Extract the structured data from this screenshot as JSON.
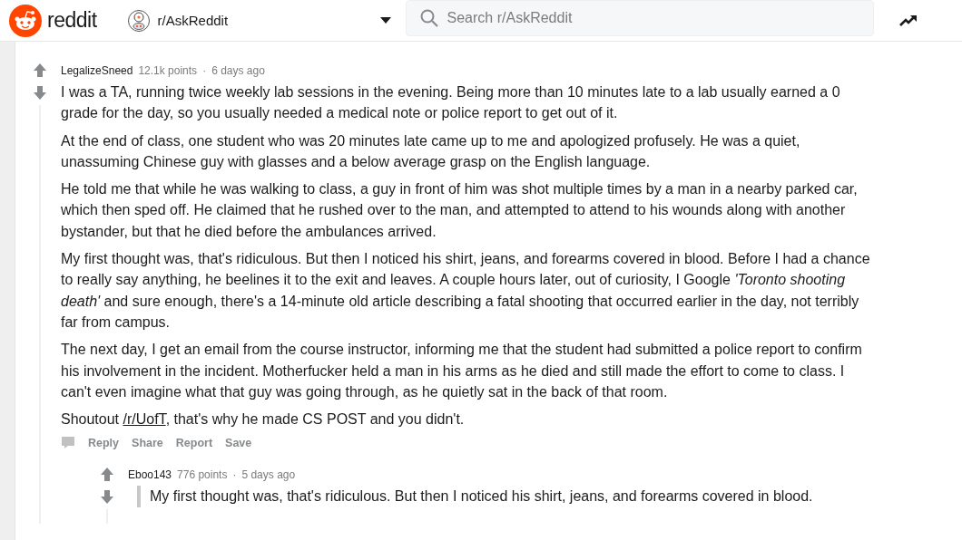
{
  "header": {
    "logo_text": "reddit",
    "subreddit": "r/AskReddit",
    "search": {
      "placeholder": "Search r/AskReddit"
    }
  },
  "comments": [
    {
      "author": "LegalizeSneed",
      "points": "12.1k points",
      "separator": "·",
      "time": "6 days ago",
      "paragraphs": [
        {
          "kind": "text",
          "parts": [
            {
              "kind": "text",
              "text": "I was a TA, running twice weekly lab sessions in the evening. Being more than 10 minutes late to a lab usually earned a 0 grade for the day, so you usually needed a medical note or police report to get out of it."
            }
          ]
        },
        {
          "kind": "text",
          "parts": [
            {
              "kind": "text",
              "text": "At the end of class, one student who was 20 minutes late came up to me and apologized profusely. He was a quiet, unassuming Chinese guy with glasses and a below average grasp on the English language."
            }
          ]
        },
        {
          "kind": "text",
          "parts": [
            {
              "kind": "text",
              "text": "He told me that while he was walking to class, a guy in front of him was shot multiple times by a man in a nearby parked car, which then sped off. He claimed that he rushed over to the man, and attempted to attend to his wounds along with another bystander, but that he died before the ambulances arrived."
            }
          ]
        },
        {
          "kind": "text",
          "parts": [
            {
              "kind": "text",
              "text": "My first thought was, that's ridiculous. But then I noticed his shirt, jeans, and forearms covered in blood. Before I had a chance to really say anything, he beelines it to the exit and leaves. A couple hours later, out of curiosity, I Google *'Toronto shooting death'* and sure enough, there's a 14-minute old article describing a fatal shooting that occurred earlier in the day, not terribly far from campus."
            }
          ]
        },
        {
          "kind": "text",
          "parts": [
            {
              "kind": "text",
              "text": "The next day, I get an email from the course instructor, informing me that the student had submitted a police report to confirm his involvement in the incident. Motherfucker held a man in his arms as he died and still made the effort to come to class. I can't even imagine what that guy was going through, as he quietly sat in the back of that room."
            }
          ]
        },
        {
          "kind": "text",
          "parts": [
            {
              "kind": "text",
              "text": "Shoutout "
            },
            {
              "kind": "link",
              "text": "/r/UofT"
            },
            {
              "kind": "text",
              "text": ", that's why he made CS POST and you didn't."
            }
          ]
        }
      ],
      "actions": [
        "Reply",
        "Share",
        "Report",
        "Save"
      ],
      "children": [
        {
          "author": "Eboo143",
          "points": "776 points",
          "separator": "·",
          "time": "5 days ago",
          "paragraphs": [
            {
              "kind": "quote",
              "parts": [
                {
                  "kind": "text",
                  "text": "My first thought was, that's ridiculous. But then I noticed his shirt, jeans, and forearms covered in blood."
                }
              ]
            }
          ]
        }
      ]
    }
  ]
}
